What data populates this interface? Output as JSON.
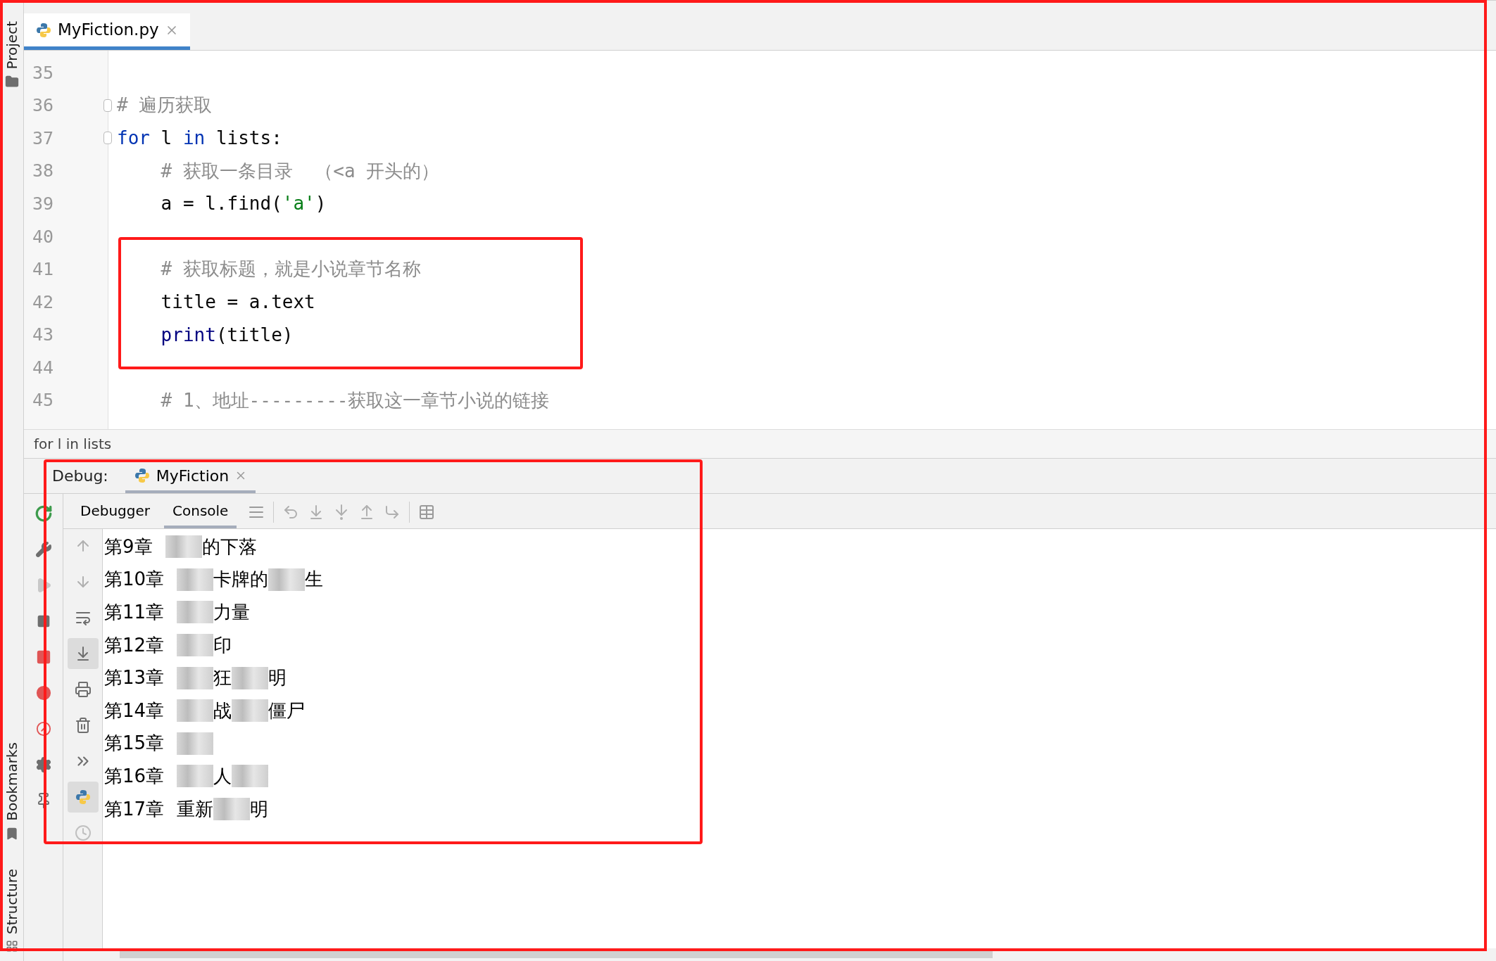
{
  "side_tools": {
    "top": [
      {
        "label": "Project"
      }
    ],
    "bottom": [
      {
        "label": "Bookmarks"
      },
      {
        "label": "Structure"
      }
    ]
  },
  "editor_tabs": [
    {
      "label": "MyFiction.py",
      "selected": true
    }
  ],
  "code_lines": [
    {
      "number": "35",
      "fold": false
    },
    {
      "number": "36",
      "fold": true,
      "tokens": [
        {
          "kind": "comment",
          "text": "# 遍历获取"
        }
      ]
    },
    {
      "number": "37",
      "fold": true,
      "tokens": [
        {
          "kind": "keyword",
          "text": "for"
        },
        {
          "kind": "plain",
          "text": " l "
        },
        {
          "kind": "keyword",
          "text": "in"
        },
        {
          "kind": "plain",
          "text": " lists:"
        }
      ]
    },
    {
      "number": "38",
      "fold": false,
      "tokens": [
        {
          "kind": "comment",
          "text": "    # 获取一条目录  （<a 开头的）"
        }
      ]
    },
    {
      "number": "39",
      "fold": false,
      "tokens": [
        {
          "kind": "plain",
          "text": "    a = l.find("
        },
        {
          "kind": "string",
          "text": "'a'"
        },
        {
          "kind": "plain",
          "text": ")"
        }
      ]
    },
    {
      "number": "40",
      "fold": false
    },
    {
      "number": "41",
      "fold": false,
      "tokens": [
        {
          "kind": "comment",
          "text": "    # 获取标题，就是小说章节名称"
        }
      ]
    },
    {
      "number": "42",
      "fold": false,
      "tokens": [
        {
          "kind": "plain",
          "text": "    title = a.text"
        }
      ]
    },
    {
      "number": "43",
      "fold": false,
      "tokens": [
        {
          "kind": "builtin",
          "text": "    print"
        },
        {
          "kind": "plain",
          "text": "(title)"
        }
      ]
    },
    {
      "number": "44",
      "fold": false
    },
    {
      "number": "45",
      "fold": false,
      "tokens": [
        {
          "kind": "comment",
          "text": "    # 1、地址---------获取这一章节小说的链接"
        }
      ]
    }
  ],
  "breadcrumb": "for l in lists",
  "debug": {
    "label": "Debug:",
    "session_tabs": [
      {
        "label": "MyFiction",
        "selected": true
      }
    ],
    "view_tabs": [
      {
        "label": "Debugger",
        "selected": false
      },
      {
        "label": "Console",
        "selected": true
      }
    ],
    "console_lines": [
      {
        "chapter": "第9章",
        "segments": [
          {
            "kind": "blur"
          },
          {
            "kind": "text",
            "text": "的下落"
          }
        ]
      },
      {
        "chapter": "第10章",
        "segments": [
          {
            "kind": "blur"
          },
          {
            "kind": "text",
            "text": "卡牌的"
          },
          {
            "kind": "blur"
          },
          {
            "kind": "text",
            "text": "生"
          }
        ]
      },
      {
        "chapter": "第11章",
        "segments": [
          {
            "kind": "blur"
          },
          {
            "kind": "text",
            "text": "力量"
          }
        ]
      },
      {
        "chapter": "第12章",
        "segments": [
          {
            "kind": "blur"
          },
          {
            "kind": "text",
            "text": "印"
          }
        ]
      },
      {
        "chapter": "第13章",
        "segments": [
          {
            "kind": "blur"
          },
          {
            "kind": "text",
            "text": "狂"
          },
          {
            "kind": "blur"
          },
          {
            "kind": "text",
            "text": "明"
          }
        ]
      },
      {
        "chapter": "第14章",
        "segments": [
          {
            "kind": "blur"
          },
          {
            "kind": "text",
            "text": "战"
          },
          {
            "kind": "blur"
          },
          {
            "kind": "text",
            "text": "僵尸"
          }
        ]
      },
      {
        "chapter": "第15章",
        "segments": [
          {
            "kind": "blur"
          }
        ]
      },
      {
        "chapter": "第16章",
        "segments": [
          {
            "kind": "blur"
          },
          {
            "kind": "text",
            "text": "人"
          },
          {
            "kind": "blur"
          }
        ]
      },
      {
        "chapter": "第17章",
        "segments": [
          {
            "kind": "text",
            "text": "重新"
          },
          {
            "kind": "blur"
          },
          {
            "kind": "text",
            "text": "明"
          }
        ]
      }
    ]
  }
}
